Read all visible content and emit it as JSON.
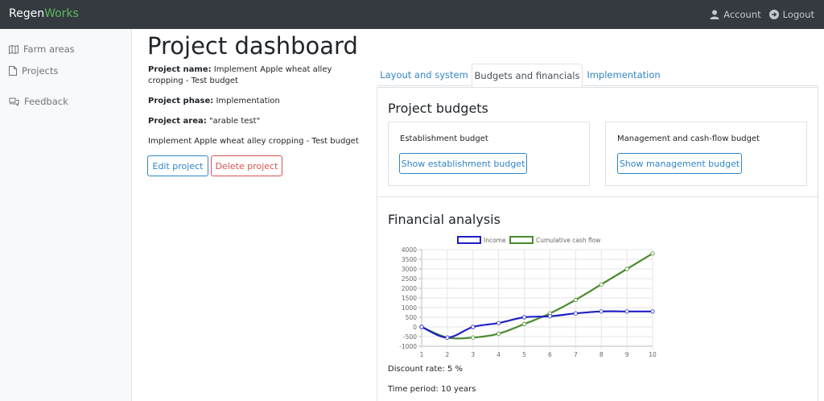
{
  "brand": {
    "part1": "Regen",
    "part2": "Works"
  },
  "topnav": {
    "account": "Account",
    "logout": "Logout"
  },
  "sidebar": {
    "items": [
      {
        "label": "Farm areas",
        "icon": "map-icon"
      },
      {
        "label": "Projects",
        "icon": "file-icon"
      },
      {
        "label": "Feedback",
        "icon": "comments-icon"
      }
    ]
  },
  "page": {
    "title": "Project dashboard",
    "project_name_label": "Project name:",
    "project_name": "Implement Apple wheat alley cropping - Test budget",
    "project_phase_label": "Project phase:",
    "project_phase": "Implementation",
    "project_area_label": "Project area:",
    "project_area": "\"arable test\"",
    "description": "Implement Apple wheat alley cropping - Test budget",
    "edit_button": "Edit project",
    "delete_button": "Delete project"
  },
  "tabs": [
    {
      "label": "Layout and system",
      "active": false
    },
    {
      "label": "Budgets and financials",
      "active": true
    },
    {
      "label": "Implementation",
      "active": false
    }
  ],
  "budgets": {
    "title": "Project budgets",
    "establishment_label": "Establishment budget",
    "establishment_button": "Show establishment budget",
    "management_label": "Management and cash-flow budget",
    "management_button": "Show management budget"
  },
  "financial": {
    "title": "Financial analysis",
    "discount_rate": "Discount rate: 5 %",
    "time_period": "Time period: 10 years"
  },
  "chart_data": {
    "type": "line",
    "x": [
      1,
      2,
      3,
      4,
      5,
      6,
      7,
      8,
      9,
      10
    ],
    "series": [
      {
        "name": "Income",
        "color": "#1f1fc6",
        "values": [
          0,
          -550,
          0,
          200,
          500,
          550,
          700,
          800,
          800,
          800
        ]
      },
      {
        "name": "Cumulative cash flow",
        "color": "#4a8a2e",
        "values": [
          0,
          -550,
          -550,
          -350,
          150,
          700,
          1400,
          2200,
          3000,
          3800
        ]
      }
    ],
    "ylim": [
      -1000,
      4000
    ],
    "yticks": [
      4000,
      3500,
      3000,
      2500,
      2000,
      1500,
      1000,
      500,
      0,
      -500,
      -1000
    ],
    "xticks": [
      1,
      2,
      3,
      4,
      5,
      6,
      7,
      8,
      9,
      10
    ],
    "legend": "top",
    "grid": true
  }
}
